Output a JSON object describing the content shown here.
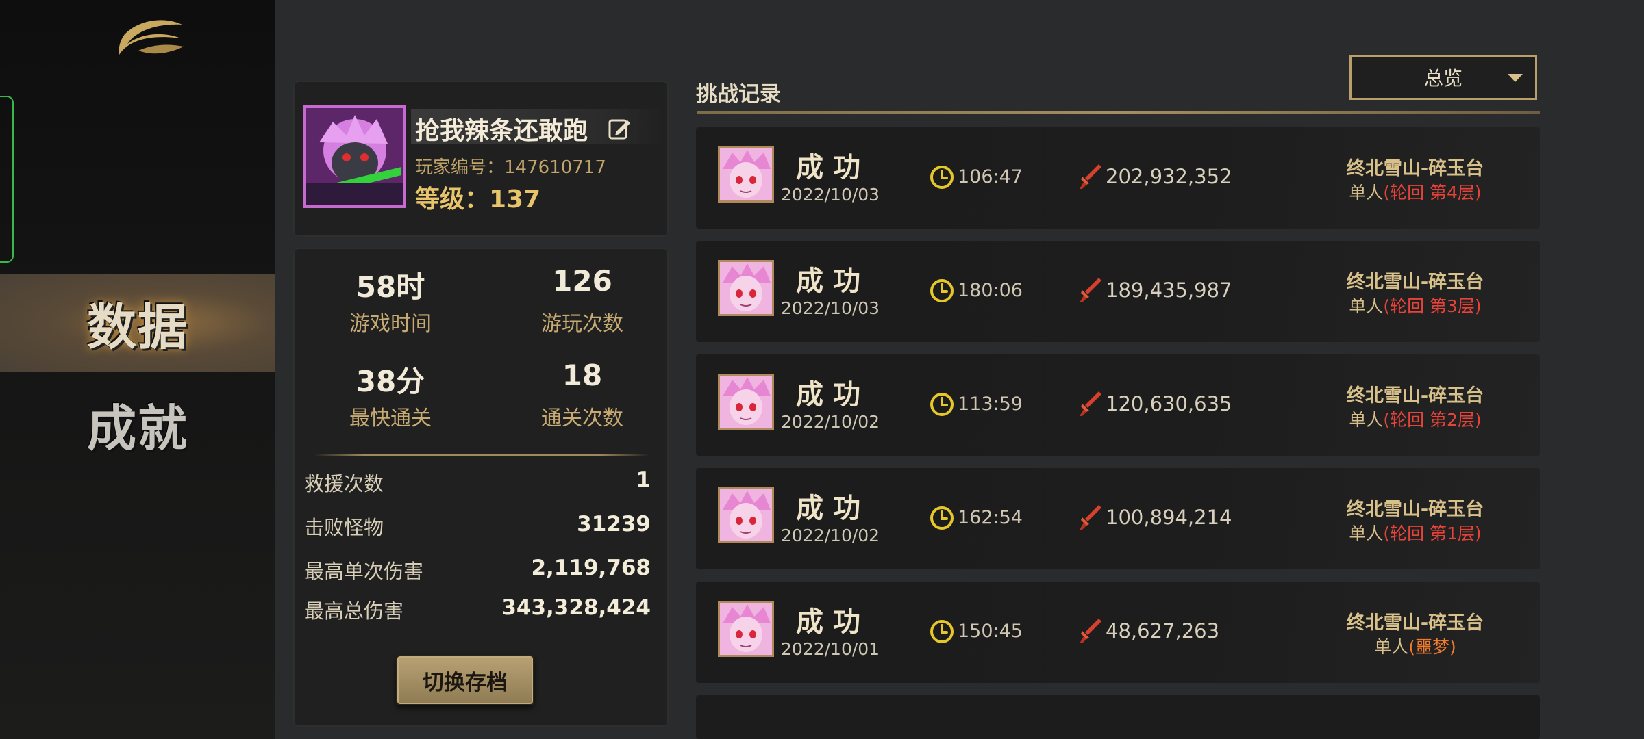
{
  "sidebar": {
    "nav": [
      {
        "label": "数据",
        "active": true
      },
      {
        "label": "成就",
        "active": false
      }
    ]
  },
  "profile": {
    "name": "抢我辣条还敢跑",
    "id_label": "玩家编号：147610717",
    "level_label": "等级：137"
  },
  "stats": {
    "big": [
      {
        "value": "58时",
        "label": "游戏时间"
      },
      {
        "value": "126",
        "label": "游玩次数"
      },
      {
        "value": "38分",
        "label": "最快通关"
      },
      {
        "value": "18",
        "label": "通关次数"
      }
    ],
    "rows": [
      {
        "label": "救援次数",
        "value": "1"
      },
      {
        "label": "击败怪物",
        "value": "31239"
      },
      {
        "label": "最高单次伤害",
        "value": "2,119,768"
      },
      {
        "label": "最高总伤害",
        "value": "343,328,424"
      }
    ],
    "switch_button": "切换存档"
  },
  "records": {
    "title": "挑战记录",
    "filter": "总览",
    "items": [
      {
        "result": "成功",
        "date": "2022/10/03",
        "time": "106:47",
        "damage": "202,932,352",
        "location": "终北雪山-碎玉台",
        "mode_prefix": "单人",
        "mode_detail": "(轮回  第4层)",
        "mode_color": "red"
      },
      {
        "result": "成功",
        "date": "2022/10/03",
        "time": "180:06",
        "damage": "189,435,987",
        "location": "终北雪山-碎玉台",
        "mode_prefix": "单人",
        "mode_detail": "(轮回  第3层)",
        "mode_color": "red"
      },
      {
        "result": "成功",
        "date": "2022/10/02",
        "time": "113:59",
        "damage": "120,630,635",
        "location": "终北雪山-碎玉台",
        "mode_prefix": "单人",
        "mode_detail": "(轮回  第2层)",
        "mode_color": "red"
      },
      {
        "result": "成功",
        "date": "2022/10/02",
        "time": "162:54",
        "damage": "100,894,214",
        "location": "终北雪山-碎玉台",
        "mode_prefix": "单人",
        "mode_detail": "(轮回  第1层)",
        "mode_color": "red"
      },
      {
        "result": "成功",
        "date": "2022/10/01",
        "time": "150:45",
        "damage": "48,627,263",
        "location": "终北雪山-碎玉台",
        "mode_prefix": "单人",
        "mode_detail": "(噩梦)",
        "mode_color": "orange"
      }
    ]
  },
  "icons": {
    "logo": "game-logo-icon",
    "edit": "edit-pencil-icon",
    "clock": "clock-icon",
    "damage": "sword-icon",
    "dropdown": "triangle-down-icon"
  },
  "colors": {
    "accent_gold": "#c7ab72",
    "success_text": "#efe4c7",
    "mode_red": "#e8433a",
    "mode_orange": "#f17a2c",
    "avatar_border": "#c76ad0"
  }
}
